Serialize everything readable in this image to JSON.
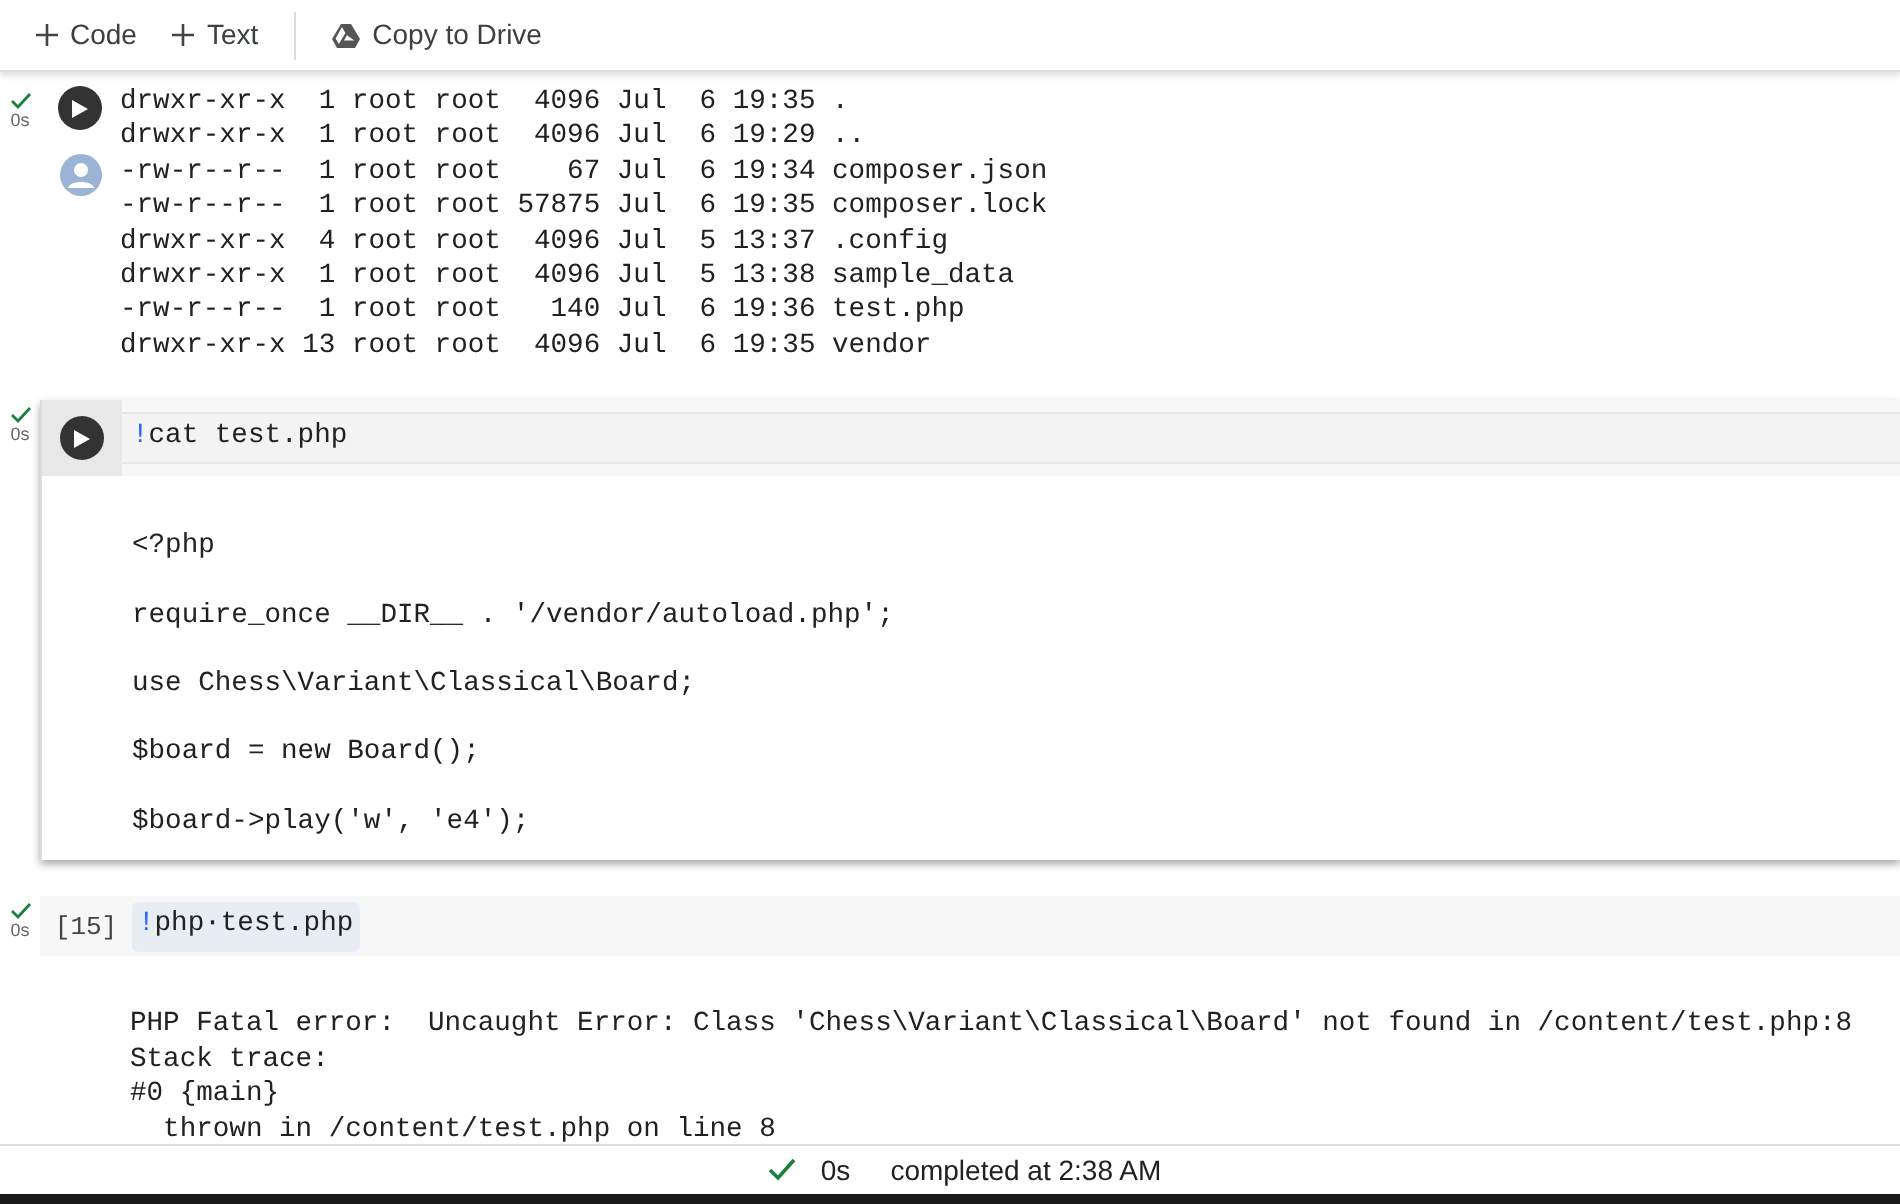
{
  "toolbar": {
    "buttons": [
      {
        "kind": "add",
        "label": "Code"
      },
      {
        "kind": "add",
        "label": "Text"
      },
      {
        "kind": "drive",
        "label": "Copy to Drive"
      }
    ]
  },
  "cells": [
    {
      "selected": false,
      "run_status": "0s",
      "show_run_button": true,
      "show_avatar": true,
      "spaced_output": false,
      "output": [
        "drwxr-xr-x  1 root root  4096 Jul  6 19:35 .",
        "drwxr-xr-x  1 root root  4096 Jul  6 19:29 ..",
        "-rw-r--r--  1 root root    67 Jul  6 19:34 composer.json",
        "-rw-r--r--  1 root root 57875 Jul  6 19:35 composer.lock",
        "drwxr-xr-x  4 root root  4096 Jul  5 13:37 .config",
        "drwxr-xr-x  1 root root  4096 Jul  5 13:38 sample_data",
        "-rw-r--r--  1 root root   140 Jul  6 19:36 test.php",
        "drwxr-xr-x 13 root root  4096 Jul  6 19:35 vendor"
      ]
    },
    {
      "selected": true,
      "run_status": "0s",
      "show_run_button": true,
      "show_avatar": false,
      "magic": "!",
      "code": "cat test.php",
      "spaced_output": true,
      "output": [
        "<?php",
        "require_once __DIR__ . '/vendor/autoload.php';",
        "use Chess\\Variant\\Classical\\Board;",
        "$board = new Board();",
        "$board->play('w', 'e4');"
      ]
    },
    {
      "selected": false,
      "run_status": "0s",
      "show_run_button": false,
      "show_avatar": false,
      "execution_count": "[15]",
      "magic": "!",
      "code": "php·test.php",
      "spaced_output": false,
      "output": [
        "PHP Fatal error:  Uncaught Error: Class 'Chess\\Variant\\Classical\\Board' not found in /content/test.php:8",
        "Stack trace:",
        "#0 {main}",
        "  thrown in /content/test.php on line 8"
      ]
    }
  ],
  "status_bar": {
    "duration": "0s",
    "message": "completed at 2:38 AM"
  }
}
